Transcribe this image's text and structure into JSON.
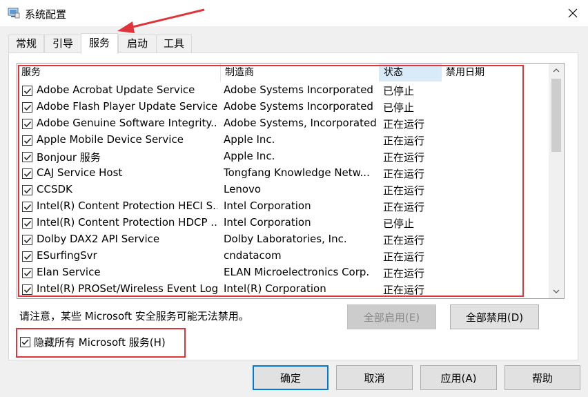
{
  "window": {
    "title": "系统配置",
    "close_icon": "close-icon",
    "app_icon": "system-config-icon"
  },
  "tabs": [
    {
      "label": "常规",
      "active": false
    },
    {
      "label": "引导",
      "active": false
    },
    {
      "label": "服务",
      "active": true
    },
    {
      "label": "启动",
      "active": false
    },
    {
      "label": "工具",
      "active": false
    }
  ],
  "table": {
    "columns": [
      "服务",
      "制造商",
      "状态",
      "禁用日期"
    ],
    "sorted_column": "状态",
    "rows": [
      {
        "name": "Adobe Acrobat Update Service",
        "manufacturer": "Adobe Systems Incorporated",
        "status": "已停止",
        "checked": true
      },
      {
        "name": "Adobe Flash Player Update Service",
        "manufacturer": "Adobe Systems Incorporated",
        "status": "已停止",
        "checked": true
      },
      {
        "name": "Adobe Genuine Software Integrity...",
        "manufacturer": "Adobe Systems, Incorporated",
        "status": "正在运行",
        "checked": true
      },
      {
        "name": "Apple Mobile Device Service",
        "manufacturer": "Apple Inc.",
        "status": "正在运行",
        "checked": true
      },
      {
        "name": "Bonjour 服务",
        "manufacturer": "Apple Inc.",
        "status": "正在运行",
        "checked": true
      },
      {
        "name": "CAJ Service Host",
        "manufacturer": "Tongfang Knowledge Netw...",
        "status": "正在运行",
        "checked": true
      },
      {
        "name": "CCSDK",
        "manufacturer": "Lenovo",
        "status": "正在运行",
        "checked": true
      },
      {
        "name": "Intel(R) Content Protection HECI S...",
        "manufacturer": "Intel Corporation",
        "status": "正在运行",
        "checked": true
      },
      {
        "name": "Intel(R) Content Protection HDCP ...",
        "manufacturer": "Intel Corporation",
        "status": "已停止",
        "checked": true
      },
      {
        "name": "Dolby DAX2 API Service",
        "manufacturer": "Dolby Laboratories, Inc.",
        "status": "正在运行",
        "checked": true
      },
      {
        "name": "ESurfingSvr",
        "manufacturer": "cndatacom",
        "status": "正在运行",
        "checked": true
      },
      {
        "name": "Elan Service",
        "manufacturer": "ELAN Microelectronics Corp.",
        "status": "正在运行",
        "checked": true
      },
      {
        "name": "Intel(R) PROSet/Wireless Event Log",
        "manufacturer": "Intel(R) Corporation",
        "status": "正在运行",
        "checked": true
      }
    ]
  },
  "note": "请注意，某些 Microsoft 安全服务可能无法禁用。",
  "buttons": {
    "enable_all": "全部启用(E)",
    "disable_all": "全部禁用(D)",
    "ok": "确定",
    "cancel": "取消",
    "apply": "应用(A)",
    "help": "帮助"
  },
  "hide_ms": {
    "label": "隐藏所有 Microsoft 服务(H)",
    "checked": true
  },
  "annotation_color": "#e0343a"
}
